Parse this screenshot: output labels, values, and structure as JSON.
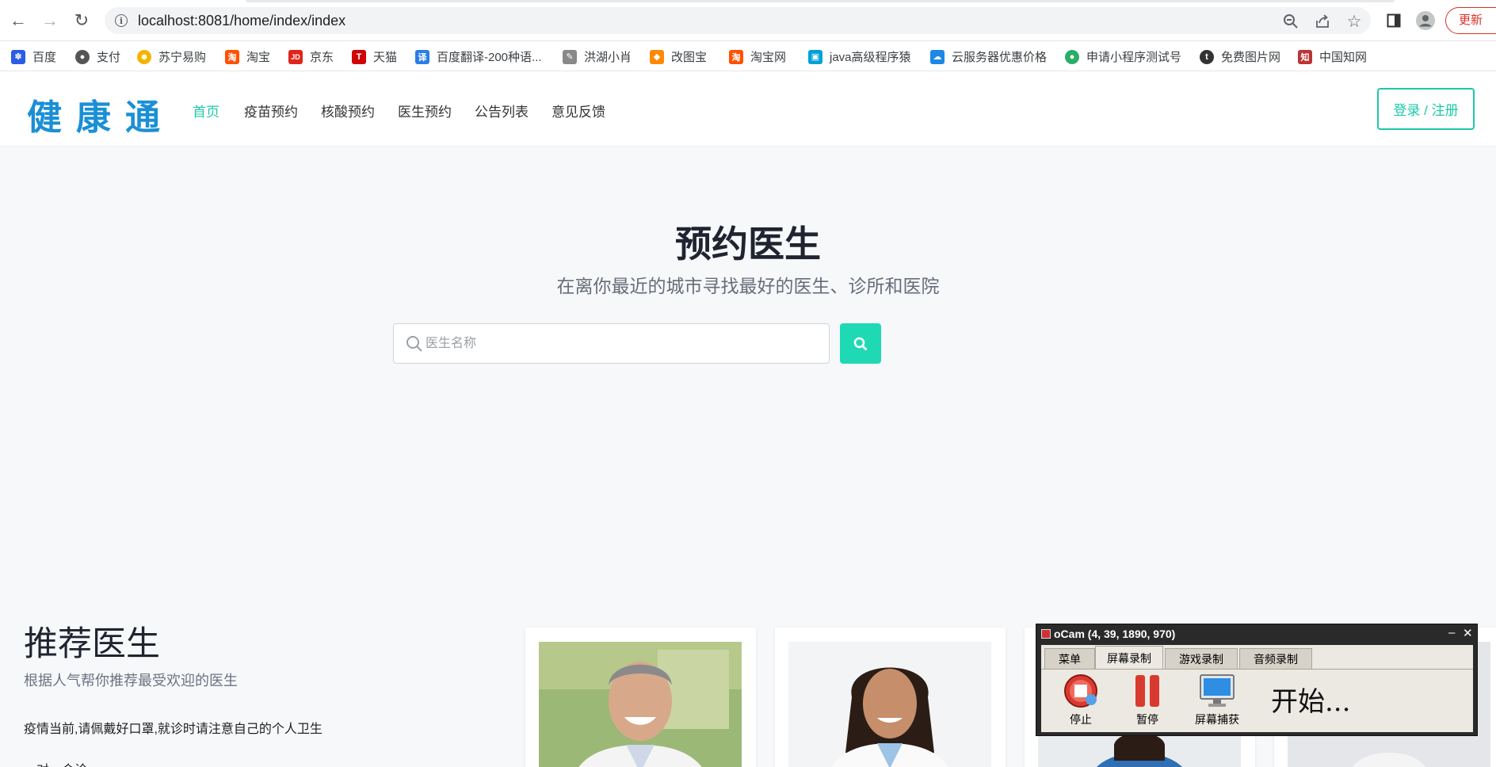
{
  "browser": {
    "url": "localhost:8081/home/index/index",
    "update_label": "更新",
    "bookmarks": [
      {
        "label": "百度",
        "color": "#2b5ce6",
        "glyph": "✽"
      },
      {
        "label": "支付",
        "color": "#555555",
        "glyph": "●"
      },
      {
        "label": "苏宁易购",
        "color": "#f4b400",
        "glyph": "☻"
      },
      {
        "label": "淘宝",
        "color": "#ff5000",
        "glyph": "淘"
      },
      {
        "label": "京东",
        "color": "#e1251b",
        "glyph": "JD"
      },
      {
        "label": "天猫",
        "color": "#d10000",
        "glyph": "T"
      },
      {
        "label": "百度翻译-200种语...",
        "color": "#2b7de9",
        "glyph": "译"
      },
      {
        "label": "洪湖小肖",
        "color": "#888888",
        "glyph": "✎"
      },
      {
        "label": "改图宝",
        "color": "#ff8a00",
        "glyph": "◆"
      },
      {
        "label": "淘宝网",
        "color": "#ff5000",
        "glyph": "淘"
      },
      {
        "label": "java高级程序猿",
        "color": "#00a1d6",
        "glyph": "▣"
      },
      {
        "label": "云服务器优惠价格",
        "color": "#1e88e5",
        "glyph": "☁"
      },
      {
        "label": "申请小程序测试号",
        "color": "#2aae67",
        "glyph": "●"
      },
      {
        "label": "免费图片网",
        "color": "#333333",
        "glyph": "t"
      },
      {
        "label": "中国知网",
        "color": "#b33",
        "glyph": "知"
      }
    ]
  },
  "site": {
    "logo": "健康通",
    "nav": [
      "首页",
      "疫苗预约",
      "核酸预约",
      "医生预约",
      "公告列表",
      "意见反馈"
    ],
    "login_label": "登录 / 注册"
  },
  "hero": {
    "title": "预约医生",
    "subtitle": "在离你最近的城市寻找最好的医生、诊所和医院",
    "search_placeholder": "医生名称"
  },
  "recommend": {
    "title": "推荐医生",
    "subtitle": "根据人气帮你推荐最受欢迎的医生",
    "note": "疫情当前,请佩戴好口罩,就诊时请注意自己的个人卫生",
    "next_line": "一对一会诊"
  },
  "ocam": {
    "title": "oCam (4, 39, 1890, 970)",
    "tabs": [
      "菜单",
      "屏幕录制",
      "游戏录制",
      "音频录制"
    ],
    "tools": [
      "停止",
      "暂停",
      "屏幕捕获"
    ],
    "status": "开始..."
  }
}
